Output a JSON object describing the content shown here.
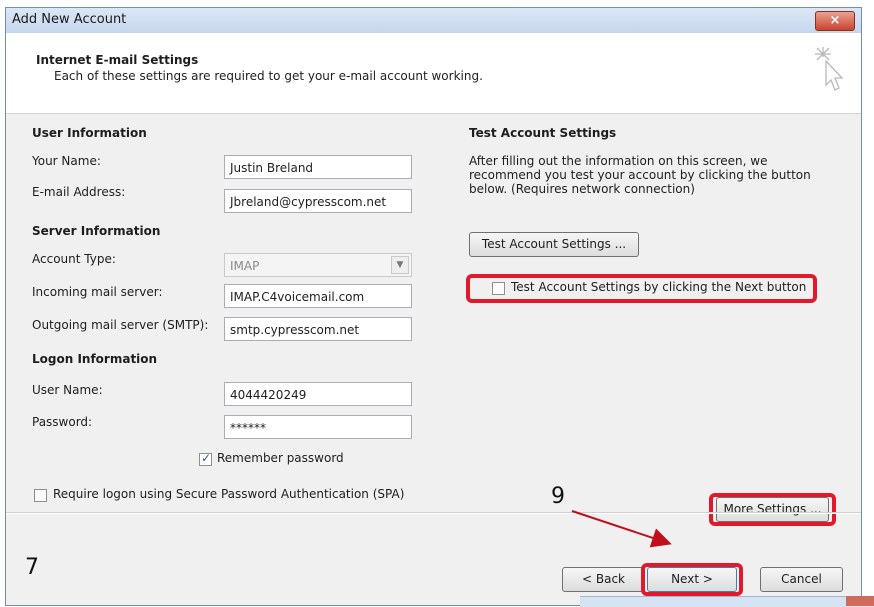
{
  "window": {
    "title": "Add New Account",
    "close_glyph": "×"
  },
  "header": {
    "title": "Internet E-mail Settings",
    "subtitle": "Each of these settings are required to get your e-mail account working."
  },
  "user_info": {
    "heading": "User Information",
    "name_label": "Your Name:",
    "name_value": "Justin Breland",
    "email_label": "E-mail Address:",
    "email_value": "Jbreland@cypresscom.net"
  },
  "server_info": {
    "heading": "Server Information",
    "account_type_label": "Account Type:",
    "account_type_value": "IMAP",
    "incoming_label": "Incoming mail server:",
    "incoming_value": "IMAP.C4voicemail.com",
    "outgoing_label": "Outgoing mail server (SMTP):",
    "outgoing_value": "smtp.cypresscom.net"
  },
  "logon_info": {
    "heading": "Logon Information",
    "username_label": "User Name:",
    "username_value": "4044420249",
    "password_label": "Password:",
    "password_value": "******",
    "remember_label": "Remember password",
    "remember_checked": true,
    "spa_label": "Require logon using Secure Password Authentication (SPA)",
    "spa_checked": false
  },
  "test_settings": {
    "heading": "Test Account Settings",
    "description": "After filling out the information on this screen, we recommend you test your account by clicking the button below. (Requires network connection)",
    "test_button": "Test Account Settings ...",
    "next_test_label": "Test Account Settings by clicking the Next button",
    "next_test_checked": false
  },
  "buttons": {
    "more_settings": "More Settings ...",
    "back": "< Back",
    "next": "Next >",
    "cancel": "Cancel"
  },
  "annotations": {
    "step_7": "7",
    "step_9": "9"
  },
  "colors": {
    "highlight": "#e0192b",
    "arrow": "#c0101e"
  }
}
